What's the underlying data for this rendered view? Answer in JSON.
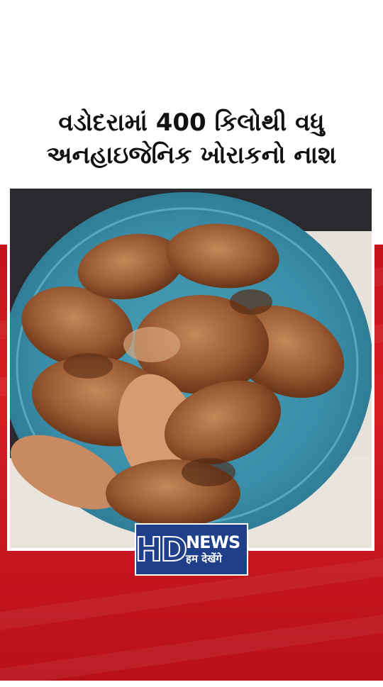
{
  "headline": {
    "line1": "વડોદરામાં 400 કિલોથી વધુ",
    "line2": "અનહાઇજેનિક ખોરાકનો નાશ"
  },
  "photo": {
    "subject": "fried-chicken-pieces-on-blue-plate"
  },
  "logo": {
    "mark": "HD",
    "name": "NEWS",
    "tagline": "हम देखेंगे"
  },
  "colors": {
    "background_top": "#ffffff",
    "background_bottom": "#d81e25",
    "logo_blue": "#1f3f8a",
    "plate_blue": "#3d92ad"
  }
}
